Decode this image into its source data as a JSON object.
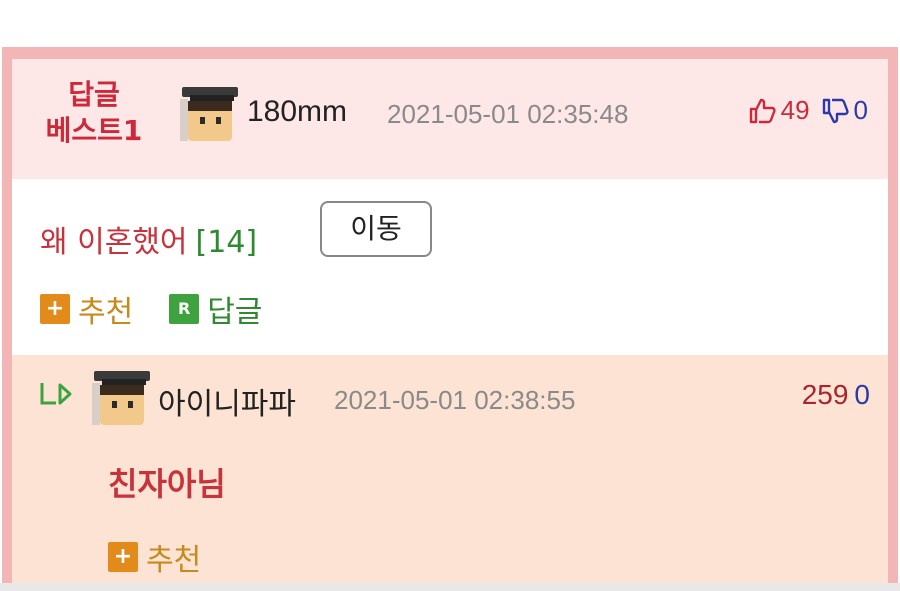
{
  "best_reply": {
    "badge_line1": "답글",
    "badge_line2": "베스트1",
    "username": "180mm",
    "datetime": "2021-05-01 02:35:48",
    "upvotes": "49",
    "downvotes": "0",
    "post_title": "왜 이혼했어",
    "post_comment_count": "[14]",
    "move_button": "이동",
    "recommend_label": "추천",
    "reply_label": "답글"
  },
  "nested_reply": {
    "username": "아이니파파",
    "datetime": "2021-05-01 02:38:55",
    "upvotes": "259",
    "downvotes": "0",
    "text": "친자아님",
    "recommend_label": "추천"
  },
  "icons": {
    "upvote": "thumbs-up-icon",
    "downvote": "thumbs-down-icon",
    "reply_arrow": "reply-arrow-icon",
    "recommend": "plus-square-icon",
    "reply": "r-square-icon"
  },
  "colors": {
    "accent_red": "#cc2a3a",
    "count_green": "#2f8a2f",
    "frame_pink": "#f2b6b6",
    "best_bg": "#fde7e7",
    "reply_bg": "#fce3d3",
    "recommend_orange": "#e28a1a"
  }
}
